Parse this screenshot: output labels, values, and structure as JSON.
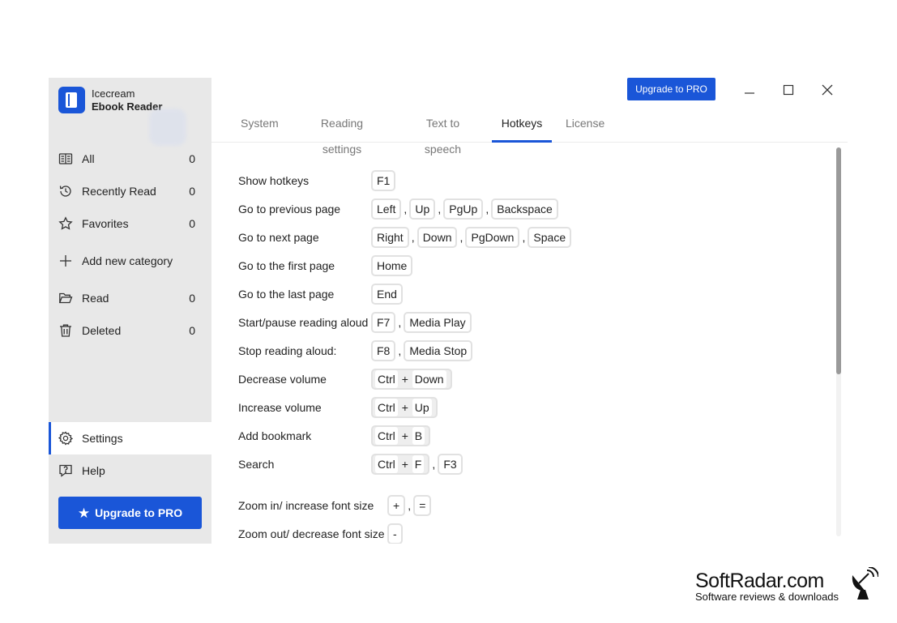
{
  "app": {
    "name_line1": "Icecream",
    "name_line2": "Ebook Reader"
  },
  "topbar": {
    "upgrade_label": "Upgrade to PRO"
  },
  "sidebar": {
    "items": [
      {
        "label": "All",
        "count": "0",
        "icon": "library-icon"
      },
      {
        "label": "Recently Read",
        "count": "0",
        "icon": "history-icon"
      },
      {
        "label": "Favorites",
        "count": "0",
        "icon": "star-icon"
      },
      {
        "label": "Add new category",
        "count": "",
        "icon": "plus-icon"
      },
      {
        "label": "Read",
        "count": "0",
        "icon": "open-folder-icon"
      },
      {
        "label": "Deleted",
        "count": "0",
        "icon": "trash-icon"
      }
    ],
    "settings_label": "Settings",
    "help_label": "Help",
    "upgrade_label": "Upgrade to PRO"
  },
  "tabs": [
    {
      "label": "System",
      "active": false
    },
    {
      "label": "Reading settings",
      "active": false
    },
    {
      "label": "Text to speech",
      "active": false
    },
    {
      "label": "Hotkeys",
      "active": true
    },
    {
      "label": "License",
      "active": false
    }
  ],
  "hotkeys": [
    {
      "label": "Show hotkeys",
      "keys": [
        "F1"
      ]
    },
    {
      "label": "Go to previous page",
      "keys": [
        "Left",
        "Up",
        "PgUp",
        "Backspace"
      ]
    },
    {
      "label": "Go to next page",
      "keys": [
        "Right",
        "Down",
        "PgDown",
        "Space"
      ]
    },
    {
      "label": "Go to the first page",
      "keys": [
        "Home"
      ]
    },
    {
      "label": "Go to the last page",
      "keys": [
        "End"
      ]
    },
    {
      "label": "Start/pause reading aloud",
      "keys": [
        "F7",
        "Media Play"
      ]
    },
    {
      "label": "Stop reading aloud:",
      "keys": [
        "F8",
        "Media Stop"
      ]
    },
    {
      "label": "Decrease volume",
      "combo": [
        "Ctrl",
        "Down"
      ]
    },
    {
      "label": "Increase volume",
      "combo": [
        "Ctrl",
        "Up"
      ]
    },
    {
      "label": "Add bookmark",
      "combo": [
        "Ctrl",
        "B"
      ]
    },
    {
      "label": "Search",
      "combo": [
        "Ctrl",
        "F"
      ],
      "alt_keys": [
        "F3"
      ]
    },
    {
      "label": "Zoom in/ increase font size",
      "keys": [
        "+",
        "="
      ]
    },
    {
      "label": "Zoom out/ decrease font size",
      "keys": [
        "-"
      ]
    }
  ],
  "combo_plus": "+",
  "key_separator": ",",
  "watermark": {
    "main": "SoftRadar.com",
    "sub": "Software reviews & downloads"
  },
  "colors": {
    "accent": "#1a56d8",
    "sidebar_bg": "#e8e8e8"
  }
}
